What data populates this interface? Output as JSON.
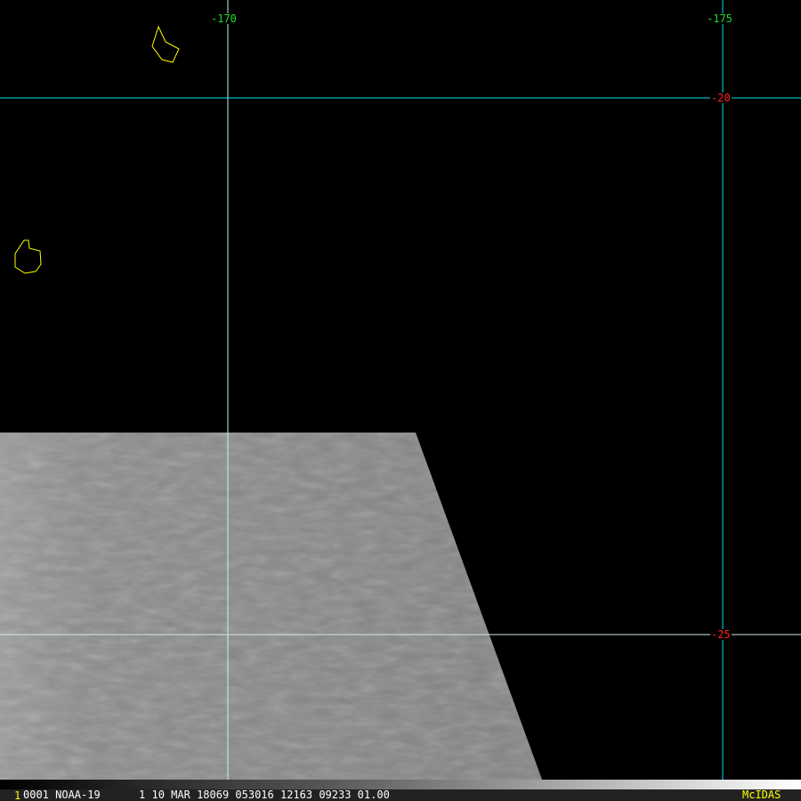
{
  "grid": {
    "longitude_labels": [
      "-170",
      "-175"
    ],
    "latitude_labels": [
      "-20",
      "-25"
    ]
  },
  "status_bar": {
    "frame_number": "1",
    "text": "0001 NOAA-19      1 10 MAR 18069 053016 12163 09233 01.00",
    "brand": "McIDAS"
  },
  "colors": {
    "grid_line": "#00e5ee",
    "longitude_label": "#22dd22",
    "latitude_label": "#ff2020",
    "coastline": "#ffff00"
  }
}
